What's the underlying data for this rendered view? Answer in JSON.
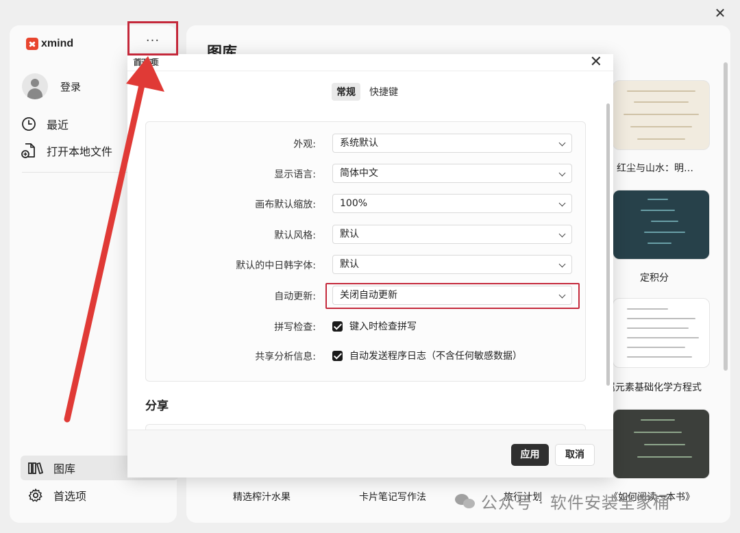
{
  "window": {
    "close_glyph": "✕"
  },
  "sidebar": {
    "app_name": "xmind",
    "more_glyph": "···",
    "login_label": "登录",
    "items": [
      {
        "label": "最近",
        "icon": "clock-icon"
      },
      {
        "label": "打开本地文件",
        "icon": "file-add-icon"
      }
    ],
    "bottom_items": [
      {
        "label": "图库",
        "icon": "library-icon",
        "active": true
      },
      {
        "label": "首选项",
        "icon": "gear-icon"
      }
    ]
  },
  "main": {
    "title": "图库",
    "cards": [
      {
        "label": "、红尘与山水：明…"
      },
      {
        "label": "定积分"
      },
      {
        "label": "属元素基础化学方程式"
      },
      {
        "label": ""
      }
    ],
    "bottom_labels": [
      "精选榨汁水果",
      "卡片笔记写作法",
      "旅行计划",
      "《如何阅读一本书》"
    ]
  },
  "tooltip": "首选项",
  "dialog": {
    "title": "首选项",
    "close_glyph": "✕",
    "tabs": [
      {
        "label": "常规",
        "active": true
      },
      {
        "label": "快捷键",
        "active": false
      }
    ],
    "settings": [
      {
        "label": "外观:",
        "value": "系统默认"
      },
      {
        "label": "显示语言:",
        "value": "简体中文"
      },
      {
        "label": "画布默认缩放:",
        "value": "100%"
      },
      {
        "label": "默认风格:",
        "value": "默认"
      },
      {
        "label": "默认的中日韩字体:",
        "value": "默认"
      },
      {
        "label": "自动更新:",
        "value": "关闭自动更新",
        "highlighted": true
      }
    ],
    "checkboxes": [
      {
        "label": "拼写检查:",
        "text": "键入时检查拼写",
        "checked": true
      },
      {
        "label": "共享分析信息:",
        "text": "自动发送程序日志（不含任何敏感数据）",
        "checked": true
      }
    ],
    "section_title": "分享",
    "apply_label": "应用",
    "cancel_label": "取消"
  },
  "watermark": {
    "text": "公众号 · 软件安装全家桶"
  },
  "colors": {
    "annotation_red": "#c4283a",
    "brand_red": "#e8452e",
    "primary_button": "#2f2f2f"
  }
}
